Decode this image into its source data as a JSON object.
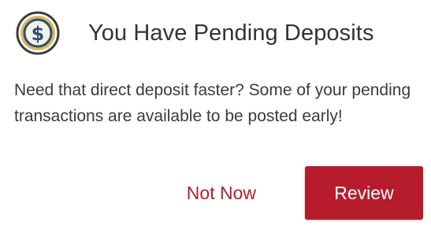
{
  "dialog": {
    "title": "You Have Pending Deposits",
    "icon": "dollar-coin-icon",
    "message": "Need that direct deposit faster? Some of your pending transactions are available to be posted early!",
    "secondary_label": "Not Now",
    "primary_label": "Review"
  },
  "colors": {
    "accent": "#b71c2d",
    "coin_gold": "#d9b95a",
    "coin_blue": "#2e4e73"
  }
}
